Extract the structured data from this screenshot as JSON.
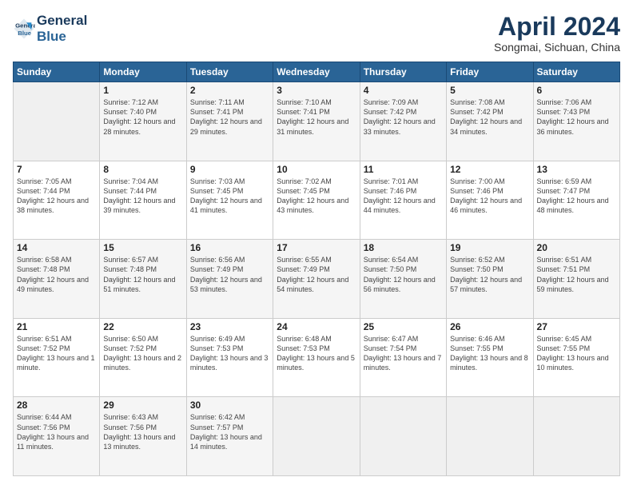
{
  "header": {
    "logo_line1": "General",
    "logo_line2": "Blue",
    "month_title": "April 2024",
    "subtitle": "Songmai, Sichuan, China"
  },
  "days_of_week": [
    "Sunday",
    "Monday",
    "Tuesday",
    "Wednesday",
    "Thursday",
    "Friday",
    "Saturday"
  ],
  "weeks": [
    [
      {
        "day": "",
        "sunrise": "",
        "sunset": "",
        "daylight": "",
        "empty": true
      },
      {
        "day": "1",
        "sunrise": "Sunrise: 7:12 AM",
        "sunset": "Sunset: 7:40 PM",
        "daylight": "Daylight: 12 hours and 28 minutes."
      },
      {
        "day": "2",
        "sunrise": "Sunrise: 7:11 AM",
        "sunset": "Sunset: 7:41 PM",
        "daylight": "Daylight: 12 hours and 29 minutes."
      },
      {
        "day": "3",
        "sunrise": "Sunrise: 7:10 AM",
        "sunset": "Sunset: 7:41 PM",
        "daylight": "Daylight: 12 hours and 31 minutes."
      },
      {
        "day": "4",
        "sunrise": "Sunrise: 7:09 AM",
        "sunset": "Sunset: 7:42 PM",
        "daylight": "Daylight: 12 hours and 33 minutes."
      },
      {
        "day": "5",
        "sunrise": "Sunrise: 7:08 AM",
        "sunset": "Sunset: 7:42 PM",
        "daylight": "Daylight: 12 hours and 34 minutes."
      },
      {
        "day": "6",
        "sunrise": "Sunrise: 7:06 AM",
        "sunset": "Sunset: 7:43 PM",
        "daylight": "Daylight: 12 hours and 36 minutes."
      }
    ],
    [
      {
        "day": "7",
        "sunrise": "Sunrise: 7:05 AM",
        "sunset": "Sunset: 7:44 PM",
        "daylight": "Daylight: 12 hours and 38 minutes."
      },
      {
        "day": "8",
        "sunrise": "Sunrise: 7:04 AM",
        "sunset": "Sunset: 7:44 PM",
        "daylight": "Daylight: 12 hours and 39 minutes."
      },
      {
        "day": "9",
        "sunrise": "Sunrise: 7:03 AM",
        "sunset": "Sunset: 7:45 PM",
        "daylight": "Daylight: 12 hours and 41 minutes."
      },
      {
        "day": "10",
        "sunrise": "Sunrise: 7:02 AM",
        "sunset": "Sunset: 7:45 PM",
        "daylight": "Daylight: 12 hours and 43 minutes."
      },
      {
        "day": "11",
        "sunrise": "Sunrise: 7:01 AM",
        "sunset": "Sunset: 7:46 PM",
        "daylight": "Daylight: 12 hours and 44 minutes."
      },
      {
        "day": "12",
        "sunrise": "Sunrise: 7:00 AM",
        "sunset": "Sunset: 7:46 PM",
        "daylight": "Daylight: 12 hours and 46 minutes."
      },
      {
        "day": "13",
        "sunrise": "Sunrise: 6:59 AM",
        "sunset": "Sunset: 7:47 PM",
        "daylight": "Daylight: 12 hours and 48 minutes."
      }
    ],
    [
      {
        "day": "14",
        "sunrise": "Sunrise: 6:58 AM",
        "sunset": "Sunset: 7:48 PM",
        "daylight": "Daylight: 12 hours and 49 minutes."
      },
      {
        "day": "15",
        "sunrise": "Sunrise: 6:57 AM",
        "sunset": "Sunset: 7:48 PM",
        "daylight": "Daylight: 12 hours and 51 minutes."
      },
      {
        "day": "16",
        "sunrise": "Sunrise: 6:56 AM",
        "sunset": "Sunset: 7:49 PM",
        "daylight": "Daylight: 12 hours and 53 minutes."
      },
      {
        "day": "17",
        "sunrise": "Sunrise: 6:55 AM",
        "sunset": "Sunset: 7:49 PM",
        "daylight": "Daylight: 12 hours and 54 minutes."
      },
      {
        "day": "18",
        "sunrise": "Sunrise: 6:54 AM",
        "sunset": "Sunset: 7:50 PM",
        "daylight": "Daylight: 12 hours and 56 minutes."
      },
      {
        "day": "19",
        "sunrise": "Sunrise: 6:52 AM",
        "sunset": "Sunset: 7:50 PM",
        "daylight": "Daylight: 12 hours and 57 minutes."
      },
      {
        "day": "20",
        "sunrise": "Sunrise: 6:51 AM",
        "sunset": "Sunset: 7:51 PM",
        "daylight": "Daylight: 12 hours and 59 minutes."
      }
    ],
    [
      {
        "day": "21",
        "sunrise": "Sunrise: 6:51 AM",
        "sunset": "Sunset: 7:52 PM",
        "daylight": "Daylight: 13 hours and 1 minute."
      },
      {
        "day": "22",
        "sunrise": "Sunrise: 6:50 AM",
        "sunset": "Sunset: 7:52 PM",
        "daylight": "Daylight: 13 hours and 2 minutes."
      },
      {
        "day": "23",
        "sunrise": "Sunrise: 6:49 AM",
        "sunset": "Sunset: 7:53 PM",
        "daylight": "Daylight: 13 hours and 3 minutes."
      },
      {
        "day": "24",
        "sunrise": "Sunrise: 6:48 AM",
        "sunset": "Sunset: 7:53 PM",
        "daylight": "Daylight: 13 hours and 5 minutes."
      },
      {
        "day": "25",
        "sunrise": "Sunrise: 6:47 AM",
        "sunset": "Sunset: 7:54 PM",
        "daylight": "Daylight: 13 hours and 7 minutes."
      },
      {
        "day": "26",
        "sunrise": "Sunrise: 6:46 AM",
        "sunset": "Sunset: 7:55 PM",
        "daylight": "Daylight: 13 hours and 8 minutes."
      },
      {
        "day": "27",
        "sunrise": "Sunrise: 6:45 AM",
        "sunset": "Sunset: 7:55 PM",
        "daylight": "Daylight: 13 hours and 10 minutes."
      }
    ],
    [
      {
        "day": "28",
        "sunrise": "Sunrise: 6:44 AM",
        "sunset": "Sunset: 7:56 PM",
        "daylight": "Daylight: 13 hours and 11 minutes."
      },
      {
        "day": "29",
        "sunrise": "Sunrise: 6:43 AM",
        "sunset": "Sunset: 7:56 PM",
        "daylight": "Daylight: 13 hours and 13 minutes."
      },
      {
        "day": "30",
        "sunrise": "Sunrise: 6:42 AM",
        "sunset": "Sunset: 7:57 PM",
        "daylight": "Daylight: 13 hours and 14 minutes."
      },
      {
        "day": "",
        "sunrise": "",
        "sunset": "",
        "daylight": "",
        "empty": true
      },
      {
        "day": "",
        "sunrise": "",
        "sunset": "",
        "daylight": "",
        "empty": true
      },
      {
        "day": "",
        "sunrise": "",
        "sunset": "",
        "daylight": "",
        "empty": true
      },
      {
        "day": "",
        "sunrise": "",
        "sunset": "",
        "daylight": "",
        "empty": true
      }
    ]
  ]
}
